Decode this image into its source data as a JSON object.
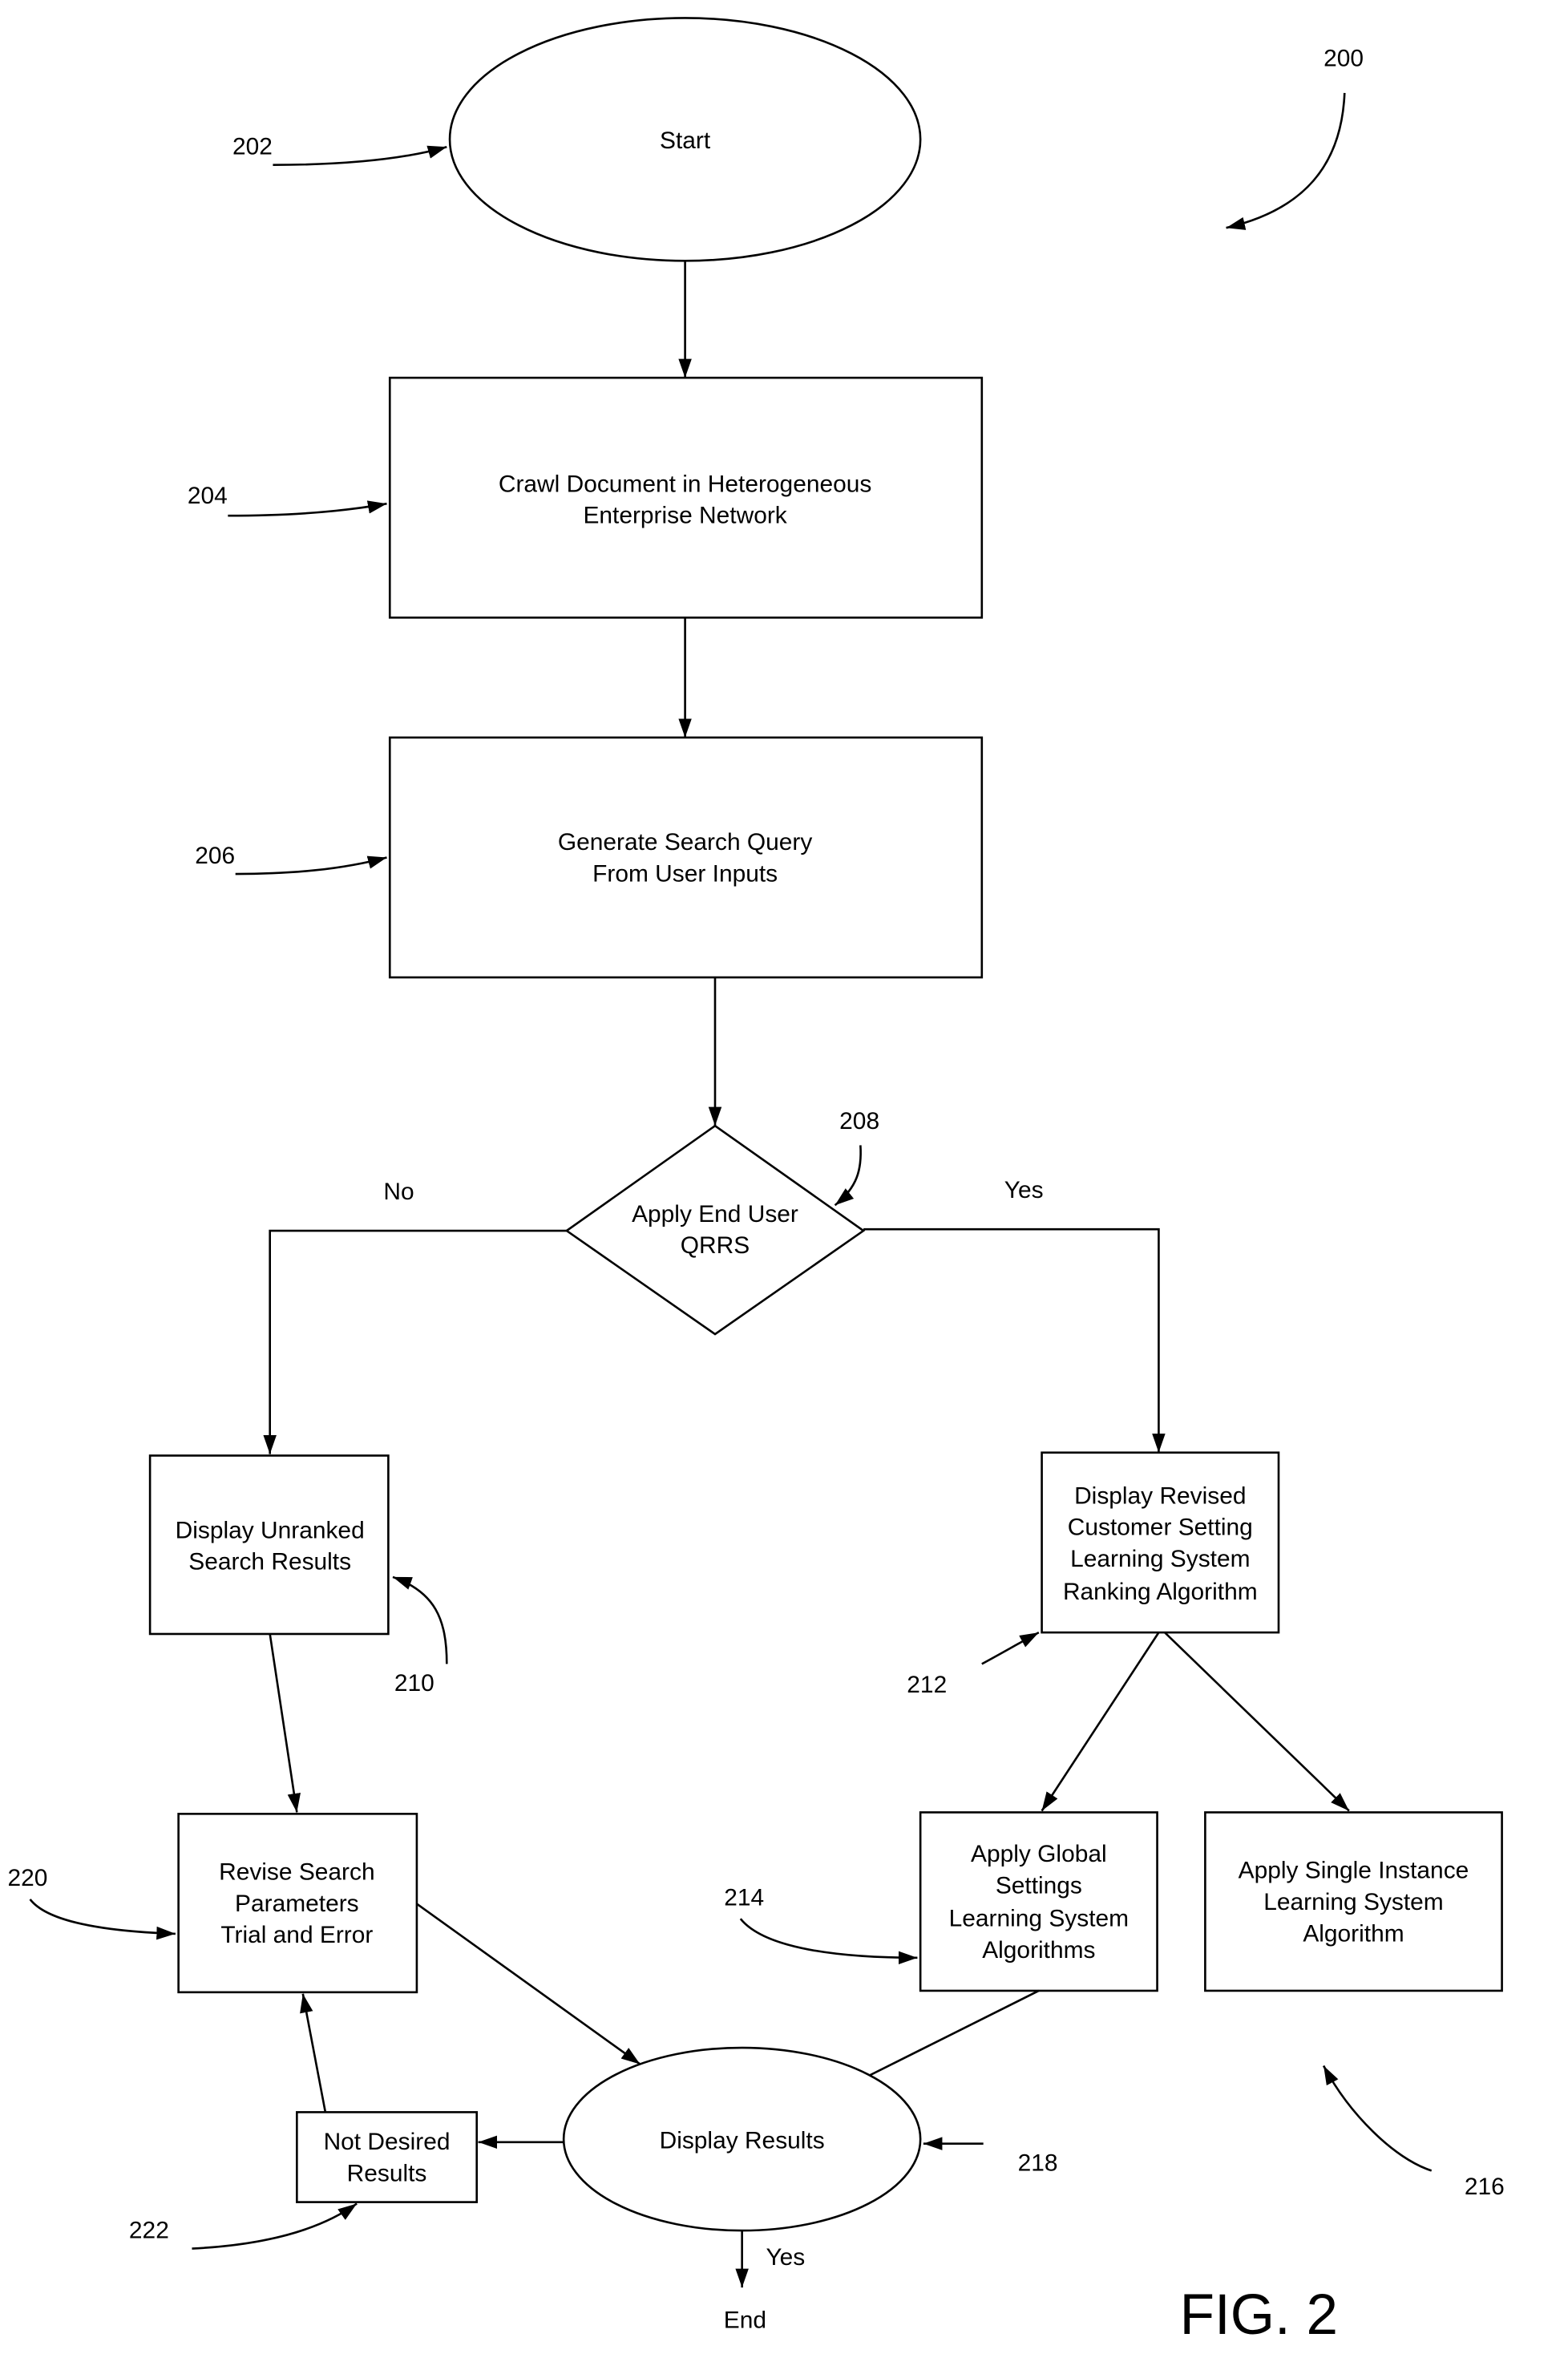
{
  "figure": {
    "number": "200",
    "caption": "FIG. 2"
  },
  "nodes": {
    "start": {
      "ref": "202",
      "lines": [
        "Start"
      ]
    },
    "crawl": {
      "ref": "204",
      "lines": [
        "Crawl Document in Heterogeneous",
        "Enterprise Network"
      ]
    },
    "generate": {
      "ref": "206",
      "lines": [
        "Generate Search Query",
        "From User Inputs"
      ]
    },
    "decision": {
      "ref": "208",
      "lines": [
        "Apply End User",
        "QRRS"
      ],
      "no_label": "No",
      "yes_label": "Yes"
    },
    "unranked": {
      "ref": "210",
      "lines": [
        "Display Unranked",
        "Search Results"
      ]
    },
    "revised": {
      "ref": "212",
      "lines": [
        "Display Revised",
        "Customer Setting",
        "Learning System",
        "Ranking Algorithm"
      ]
    },
    "global": {
      "ref": "214",
      "lines": [
        "Apply Global",
        "Settings",
        "Learning System",
        "Algorithms"
      ]
    },
    "single": {
      "ref": "216",
      "lines": [
        "Apply Single Instance",
        "Learning System",
        "Algorithm"
      ]
    },
    "display": {
      "ref": "218",
      "lines": [
        "Display Results"
      ],
      "yes_label": "Yes",
      "end_label": "End"
    },
    "revise": {
      "ref": "220",
      "lines": [
        "Revise Search",
        "Parameters",
        "Trial and Error"
      ]
    },
    "notdesired": {
      "ref": "222",
      "lines": [
        "Not Desired",
        "Results"
      ]
    }
  }
}
